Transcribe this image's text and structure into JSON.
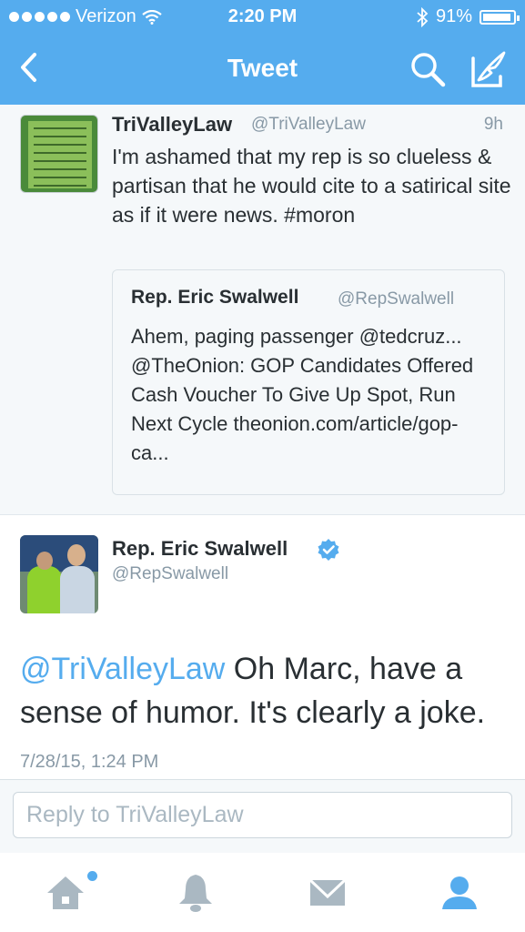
{
  "status_bar": {
    "carrier": "Verizon",
    "time": "2:20 PM",
    "battery": "91%"
  },
  "nav": {
    "title": "Tweet"
  },
  "original_tweet": {
    "name": "TriValleyLaw",
    "handle": "@TriValleyLaw",
    "time": "9h",
    "text": "I'm ashamed that my rep is so clueless & partisan that he would cite to a satirical site as if it were news. #moron",
    "quoted": {
      "name": "Rep. Eric Swalwell",
      "handle": "@RepSwalwell",
      "text": "Ahem, paging passenger @tedcruz... @TheOnion: GOP Candidates Offered Cash Voucher To Give Up Spot, Run Next Cycle theonion.com/article/gop-ca..."
    }
  },
  "main_tweet": {
    "name": "Rep. Eric Swalwell",
    "handle": "@RepSwalwell",
    "mention": "@TriValleyLaw",
    "text": " Oh Marc, have a sense of humor. It's clearly a joke.",
    "date": "7/28/15, 1:24 PM"
  },
  "reply": {
    "placeholder": "Reply to TriValleyLaw"
  },
  "tabbar": {
    "icons": [
      "home-icon",
      "notifications-icon",
      "messages-icon",
      "profile-icon"
    ]
  },
  "colors": {
    "brand": "#55ACEE",
    "text": "#292F33",
    "muted": "#8899A6"
  }
}
